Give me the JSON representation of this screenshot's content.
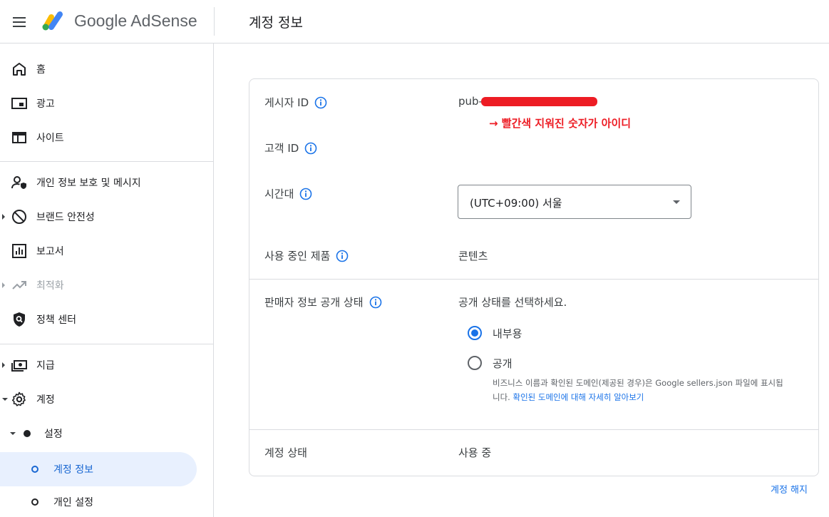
{
  "header": {
    "brand": "Google AdSense",
    "page_title": "계정 정보"
  },
  "sidebar": {
    "items": [
      {
        "label": "홈",
        "icon": "home-icon"
      },
      {
        "label": "광고",
        "icon": "ads-icon"
      },
      {
        "label": "사이트",
        "icon": "sites-icon"
      },
      {
        "label": "개인 정보 보호 및 메시지",
        "icon": "privacy-icon"
      },
      {
        "label": "브랜드 안전성",
        "icon": "block-icon"
      },
      {
        "label": "보고서",
        "icon": "reports-icon"
      },
      {
        "label": "최적화",
        "icon": "trending-icon"
      },
      {
        "label": "정책 센터",
        "icon": "policy-icon"
      },
      {
        "label": "지급",
        "icon": "payments-icon"
      },
      {
        "label": "계정",
        "icon": "gear-icon"
      }
    ],
    "sub_items": [
      {
        "label": "설정"
      },
      {
        "label": "계정 정보"
      },
      {
        "label": "개인 설정"
      }
    ]
  },
  "account": {
    "publisher_id_label": "게시자 ID",
    "publisher_id_prefix": "pub-",
    "annotation": "→ 빨간색 지워진 숫자가 아이디",
    "customer_id_label": "고객 ID",
    "timezone_label": "시간대",
    "timezone_value": "(UTC+09:00) 서울",
    "products_label": "사용 중인 제품",
    "products_value": "콘텐츠",
    "seller_info_label": "판매자 정보 공개 상태",
    "seller_info_prompt": "공개 상태를 선택하세요.",
    "option_internal": "내부용",
    "option_public": "공개",
    "helper_text": "비즈니스 이름과 확인된 도메인(제공된 경우)은 Google sellers.json 파일에 표시됩니다. ",
    "helper_link": "확인된 도메인에 대해 자세히 알아보기",
    "status_label": "계정 상태",
    "status_value": "사용 중"
  },
  "footer": {
    "close_account": "계정 해지"
  },
  "colors": {
    "accent": "#1a73e8",
    "redaction": "#ed1c24",
    "active_bg": "#e8f0fe"
  }
}
